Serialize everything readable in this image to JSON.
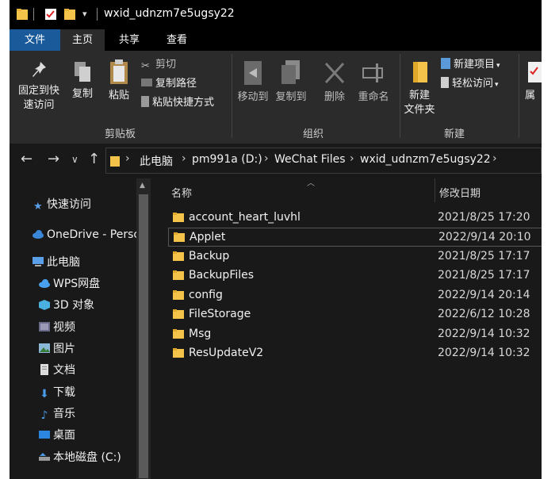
{
  "window": {
    "title": "wxid_udnzm7e5ugsy22"
  },
  "ribbon_tabs": [
    {
      "label": "文件"
    },
    {
      "label": "主页"
    },
    {
      "label": "共享"
    },
    {
      "label": "查看"
    }
  ],
  "ribbon": {
    "clipboard": {
      "group_label": "剪贴板",
      "pin_label_1": "固定到快",
      "pin_label_2": "速访问",
      "copy_label": "复制",
      "paste_label": "粘贴",
      "cut_label": "剪切",
      "copy_path_label": "复制路径",
      "paste_shortcut_label": "粘贴快捷方式"
    },
    "organize": {
      "group_label": "组织",
      "move_to_label": "移动到",
      "copy_to_label": "复制到",
      "delete_label": "删除",
      "rename_label": "重命名"
    },
    "new": {
      "group_label": "新建",
      "new_folder_label_1": "新建",
      "new_folder_label_2": "文件夹",
      "new_item_label": "新建项目",
      "easy_access_label": "轻松访问"
    },
    "properties_label": "属"
  },
  "address": {
    "crumbs": [
      "此电脑",
      "pm991a (D:)",
      "WeChat Files",
      "wxid_udnzm7e5ugsy22"
    ]
  },
  "nav_pane": {
    "items": [
      {
        "label": "快速访问",
        "icon": "star-icon"
      },
      {
        "label": "OneDrive - Persc",
        "icon": "cloud-icon"
      },
      {
        "label": "此电脑",
        "icon": "computer-icon"
      },
      {
        "label": "WPS网盘",
        "icon": "cloud-icon"
      },
      {
        "label": "3D 对象",
        "icon": "cube-icon"
      },
      {
        "label": "视频",
        "icon": "video-icon"
      },
      {
        "label": "图片",
        "icon": "picture-icon"
      },
      {
        "label": "文档",
        "icon": "document-icon"
      },
      {
        "label": "下载",
        "icon": "download-icon"
      },
      {
        "label": "音乐",
        "icon": "music-icon"
      },
      {
        "label": "桌面",
        "icon": "desktop-icon"
      },
      {
        "label": "本地磁盘 (C:)",
        "icon": "drive-icon"
      }
    ]
  },
  "columns": {
    "name": "名称",
    "date": "修改日期"
  },
  "files": [
    {
      "name": "account_heart_luvhl",
      "date": "2021/8/25 17:20"
    },
    {
      "name": "Applet",
      "date": "2022/9/14 20:10"
    },
    {
      "name": "Backup",
      "date": "2021/8/25 17:17"
    },
    {
      "name": "BackupFiles",
      "date": "2021/8/25 17:17"
    },
    {
      "name": "config",
      "date": "2022/9/14 20:14"
    },
    {
      "name": "FileStorage",
      "date": "2022/6/12 10:28"
    },
    {
      "name": "Msg",
      "date": "2022/9/14 10:32"
    },
    {
      "name": "ResUpdateV2",
      "date": "2022/9/14 10:32"
    }
  ],
  "colors": {
    "folder": "#f4c44a",
    "accent_tab": "#1a5a9a",
    "background": "#191919"
  }
}
